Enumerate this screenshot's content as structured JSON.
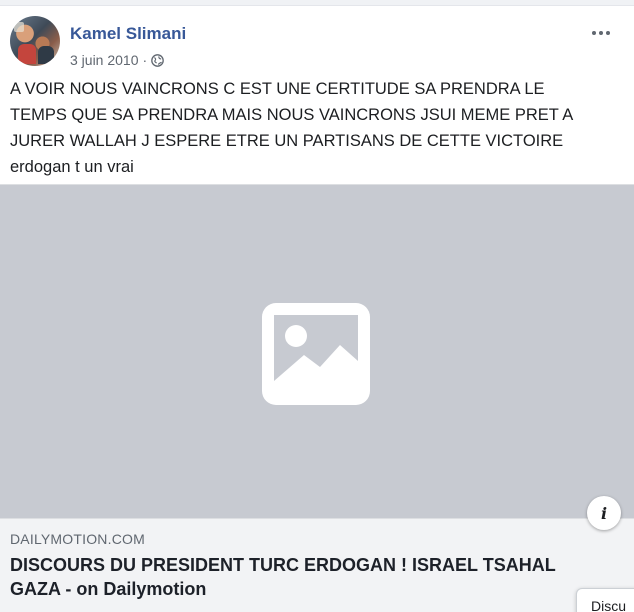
{
  "post": {
    "author": "Kamel Slimani",
    "date": "3 juin 2010",
    "separator": "·",
    "privacy_icon": "globe-icon",
    "more_icon": "more-options-icon",
    "message_lines": [
      "A VOIR NOUS VAINCRONS C EST UNE CERTITUDE SA PRENDRA LE",
      "TEMPS QUE SA PRENDRA MAIS NOUS VAINCRONS JSUI MEME PRET A",
      "JURER WALLAH J ESPERE ETRE UN PARTISANS DE CETTE VICTOIRE",
      "erdogan t un vrai"
    ]
  },
  "media": {
    "placeholder_icon": "image-placeholder-icon",
    "background": "#c7cad1"
  },
  "link_card": {
    "domain": "DAILYMOTION.COM",
    "title_lines": [
      "DISCOURS DU PRESIDENT TURC ERDOGAN ! ISRAEL TSAHAL",
      "GAZA - on Dailymotion"
    ],
    "info_label": "i"
  },
  "tooltip": {
    "text": "Discu"
  },
  "colors": {
    "author_link": "#385898",
    "secondary_text": "#606770",
    "card_background": "#f2f3f5"
  }
}
